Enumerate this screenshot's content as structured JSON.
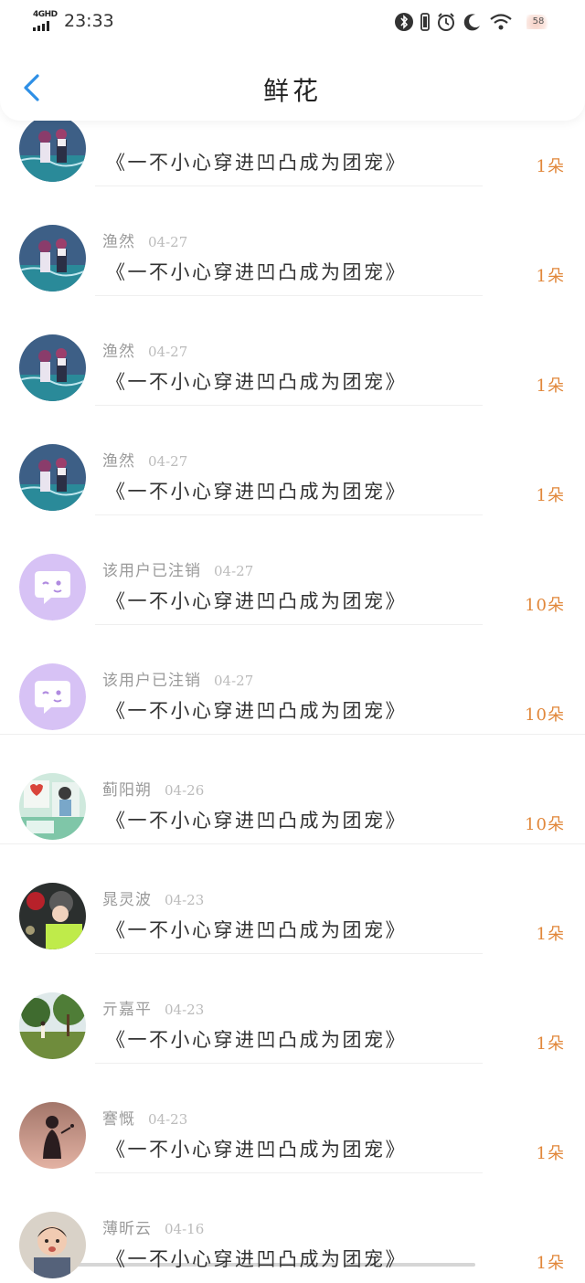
{
  "status_bar": {
    "network": "4GHD",
    "time": "23:33",
    "battery": "58",
    "icons": [
      "signal-icon",
      "bluetooth-icon",
      "battery-vibrate-icon",
      "alarm-icon",
      "moon-icon",
      "wifi-icon"
    ]
  },
  "header": {
    "back_icon": "chevron-left-icon",
    "title": "鲜花",
    "accent_color": "#2e8fe6"
  },
  "colors": {
    "count": "#e1873a",
    "name": "#9a9a9a",
    "date": "#bbbbbb",
    "title": "#333333"
  },
  "rows": [
    {
      "avatar": "anime-girls-avatar",
      "name": "",
      "date": "",
      "book": "《一不小心穿进凹凸成为团宠》",
      "count": "1朵"
    },
    {
      "avatar": "anime-girls-avatar",
      "name": "渔然",
      "date": "04-27",
      "book": "《一不小心穿进凹凸成为团宠》",
      "count": "1朵"
    },
    {
      "avatar": "anime-girls-avatar",
      "name": "渔然",
      "date": "04-27",
      "book": "《一不小心穿进凹凸成为团宠》",
      "count": "1朵"
    },
    {
      "avatar": "anime-girls-avatar",
      "name": "渔然",
      "date": "04-27",
      "book": "《一不小心穿进凹凸成为团宠》",
      "count": "1朵"
    },
    {
      "avatar": "deleted-user-avatar",
      "name": "该用户已注销",
      "date": "04-27",
      "book": "《一不小心穿进凹凸成为团宠》",
      "count": "10朵"
    },
    {
      "avatar": "deleted-user-avatar",
      "name": "该用户已注销",
      "date": "04-27",
      "book": "《一不小心穿进凹凸成为团宠》",
      "count": "10朵"
    },
    {
      "avatar": "teal-collage-avatar",
      "name": "蓟阳朔",
      "date": "04-26",
      "book": "《一不小心穿进凹凸成为团宠》",
      "count": "10朵"
    },
    {
      "avatar": "beanie-girl-avatar",
      "name": "晁灵波",
      "date": "04-23",
      "book": "《一不小心穿进凹凸成为团宠》",
      "count": "1朵"
    },
    {
      "avatar": "trees-avatar",
      "name": "亓嘉平",
      "date": "04-23",
      "book": "《一不小心穿进凹凸成为团宠》",
      "count": "1朵"
    },
    {
      "avatar": "sunset-silhouette-avatar",
      "name": "謇慨",
      "date": "04-23",
      "book": "《一不小心穿进凹凸成为团宠》",
      "count": "1朵"
    },
    {
      "avatar": "baby-avatar",
      "name": "薄昕云",
      "date": "04-16",
      "book": "《一不小心穿进凹凸成为团宠》",
      "count": "1朵"
    }
  ]
}
